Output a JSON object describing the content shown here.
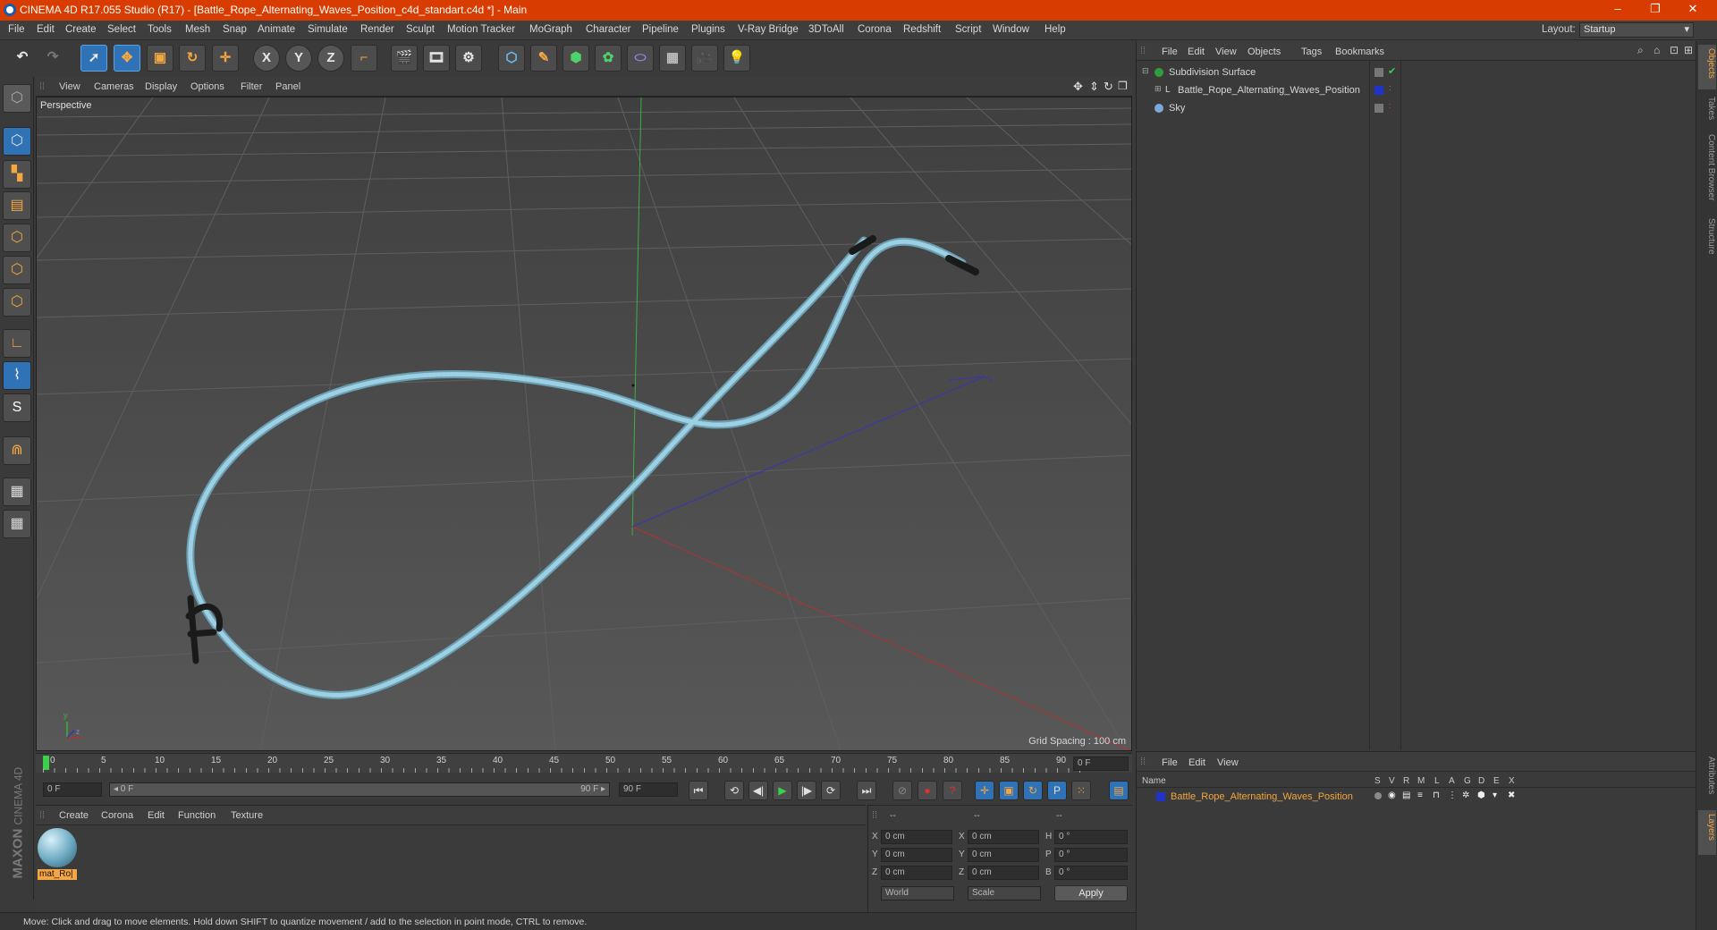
{
  "window": {
    "title": "CINEMA 4D R17.055 Studio (R17) - [Battle_Rope_Alternating_Waves_Position_c4d_standart.c4d *] - Main",
    "minimize": "–",
    "restore": "❐",
    "close": "✕"
  },
  "menubar": [
    "File",
    "Edit",
    "Create",
    "Select",
    "Tools",
    "Mesh",
    "Snap",
    "Animate",
    "Simulate",
    "Render",
    "Sculpt",
    "Motion Tracker",
    "MoGraph",
    "Character",
    "Pipeline",
    "Plugins",
    "V-Ray Bridge",
    "3DToAll",
    "Corona",
    "Redshift",
    "Script",
    "Window",
    "Help"
  ],
  "layout": {
    "label": "Layout:",
    "value": "Startup"
  },
  "toolbar": {
    "undo": "↶",
    "redo": "↷",
    "select": "➚",
    "move": "✥",
    "scale": "▣",
    "rotate": "↻",
    "transform": "✛",
    "x": "X",
    "y": "Y",
    "z": "Z",
    "coords": "⌐",
    "render_view": "🎬",
    "render": "🎞",
    "render_settings": "⚙",
    "cube": "⬡",
    "pen": "✎",
    "subdiv": "⬢",
    "cloner": "✿",
    "deformer": "⬭",
    "floor": "▦",
    "camera": "🎥",
    "light": "💡"
  },
  "left_tools": [
    "⬡",
    "▚",
    "▤",
    "⬡",
    "⬡",
    "⬡",
    "∟",
    "⌇",
    "S",
    "⋒",
    "▦",
    "▦"
  ],
  "viewport": {
    "menu": [
      "View",
      "Cameras",
      "Display",
      "Options",
      "Filter",
      "Panel"
    ],
    "label": "Perspective",
    "grid_spacing": "Grid Spacing : 100 cm",
    "rope_color": "#8fc3d6",
    "handle_color": "#1a1a1a"
  },
  "timeline": {
    "ticks": [
      "0",
      "5",
      "10",
      "15",
      "20",
      "25",
      "30",
      "35",
      "40",
      "45",
      "50",
      "55",
      "60",
      "65",
      "70",
      "75",
      "80",
      "85",
      "90"
    ],
    "current_frame": "0 F",
    "start_field": "0 F",
    "range_start": "◂ 0 F",
    "range_end": "90 F ▸",
    "end_field": "90 F"
  },
  "playback": [
    "⏮",
    "⟲",
    "◀|",
    "▶",
    "|▶",
    "⟳",
    "⏭"
  ],
  "key_buttons": [
    "⊘",
    "●",
    "?",
    "✛",
    "▣",
    "↻",
    "P",
    "⁙",
    "▤"
  ],
  "material_manager": {
    "menu": [
      "Create",
      "Corona",
      "Edit",
      "Function",
      "Texture"
    ],
    "material_name": "mat_Ro|"
  },
  "coordinates": {
    "headers": [
      "--",
      "--",
      "--"
    ],
    "rows": [
      {
        "axis": "X",
        "pos": "0 cm",
        "axis2": "X",
        "size": "0 cm",
        "rot_axis": "H",
        "rot": "0 °"
      },
      {
        "axis": "Y",
        "pos": "0 cm",
        "axis2": "Y",
        "size": "0 cm",
        "rot_axis": "P",
        "rot": "0 °"
      },
      {
        "axis": "Z",
        "pos": "0 cm",
        "axis2": "Z",
        "size": "0 cm",
        "rot_axis": "B",
        "rot": "0 °"
      }
    ],
    "world": "World",
    "scale": "Scale",
    "apply": "Apply"
  },
  "status": "Move: Click and drag to move elements. Hold down SHIFT to quantize movement / add to the selection in point mode, CTRL to remove.",
  "maxon": {
    "brand": "MAXON",
    "product": "CINEMA 4D"
  },
  "object_manager": {
    "menu": [
      "File",
      "Edit",
      "View",
      "Objects",
      "Tags",
      "Bookmarks"
    ],
    "objects": [
      {
        "name": "Subdivision Surface",
        "color": "#2f9e3a"
      },
      {
        "name": "Battle_Rope_Alternating_Waves_Position",
        "color": "#2233cc"
      },
      {
        "name": "Sky",
        "color": "#7aa9d8"
      }
    ]
  },
  "layer_manager": {
    "menu": [
      "File",
      "Edit",
      "View"
    ],
    "name_header": "Name",
    "flags": [
      "S",
      "V",
      "R",
      "M",
      "L",
      "A",
      "G",
      "D",
      "E",
      "X"
    ],
    "layer": "Battle_Rope_Alternating_Waves_Position",
    "layer_color": "#f4a640"
  },
  "side_tabs": [
    "Objects",
    "Takes",
    "Content Browser",
    "Structure",
    "Attributes",
    "Layers"
  ]
}
